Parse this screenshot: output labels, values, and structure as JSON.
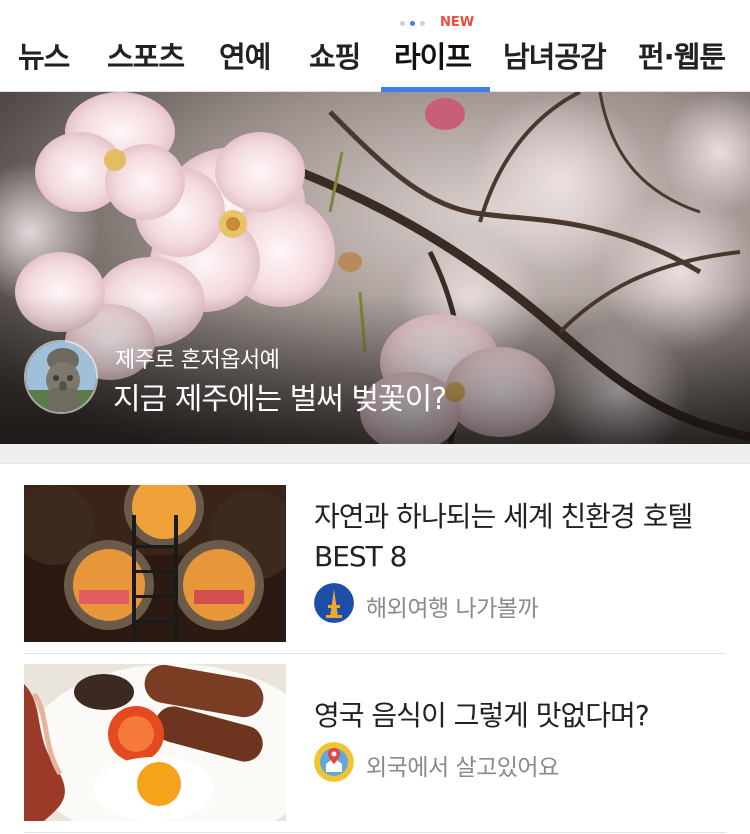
{
  "tabs": [
    {
      "label": "뉴스"
    },
    {
      "label": "스포츠"
    },
    {
      "label": "연예"
    },
    {
      "label": "쇼핑"
    },
    {
      "label": "라이프"
    },
    {
      "label": "남녀공감"
    },
    {
      "label": "펀·웹툰"
    }
  ],
  "active_tab": "라이프",
  "new_badge": "NEW",
  "colors": {
    "accent": "#3f7fe8",
    "new_badge": "#f04a3a"
  },
  "hero": {
    "channel": "제주로 혼저옵서예",
    "title": "지금 제주에는 벌써 벚꽃이?",
    "image": "cherry-blossom-photo",
    "avatar": "dol-hareubang-statue-avatar"
  },
  "articles": [
    {
      "title_line1": "자연과 하나되는 세계 친환경 호텔",
      "title_line2": "BEST 8",
      "channel": "해외여행 나가볼까",
      "thumbnail": "pipe-hotel-photo",
      "channel_icon": "eiffel-tower-icon"
    },
    {
      "title_line1": "영국 음식이 그렇게 맛없다며?",
      "channel": "외국에서 살고있어요",
      "thumbnail": "english-breakfast-photo",
      "channel_icon": "house-location-pin-icon"
    }
  ]
}
